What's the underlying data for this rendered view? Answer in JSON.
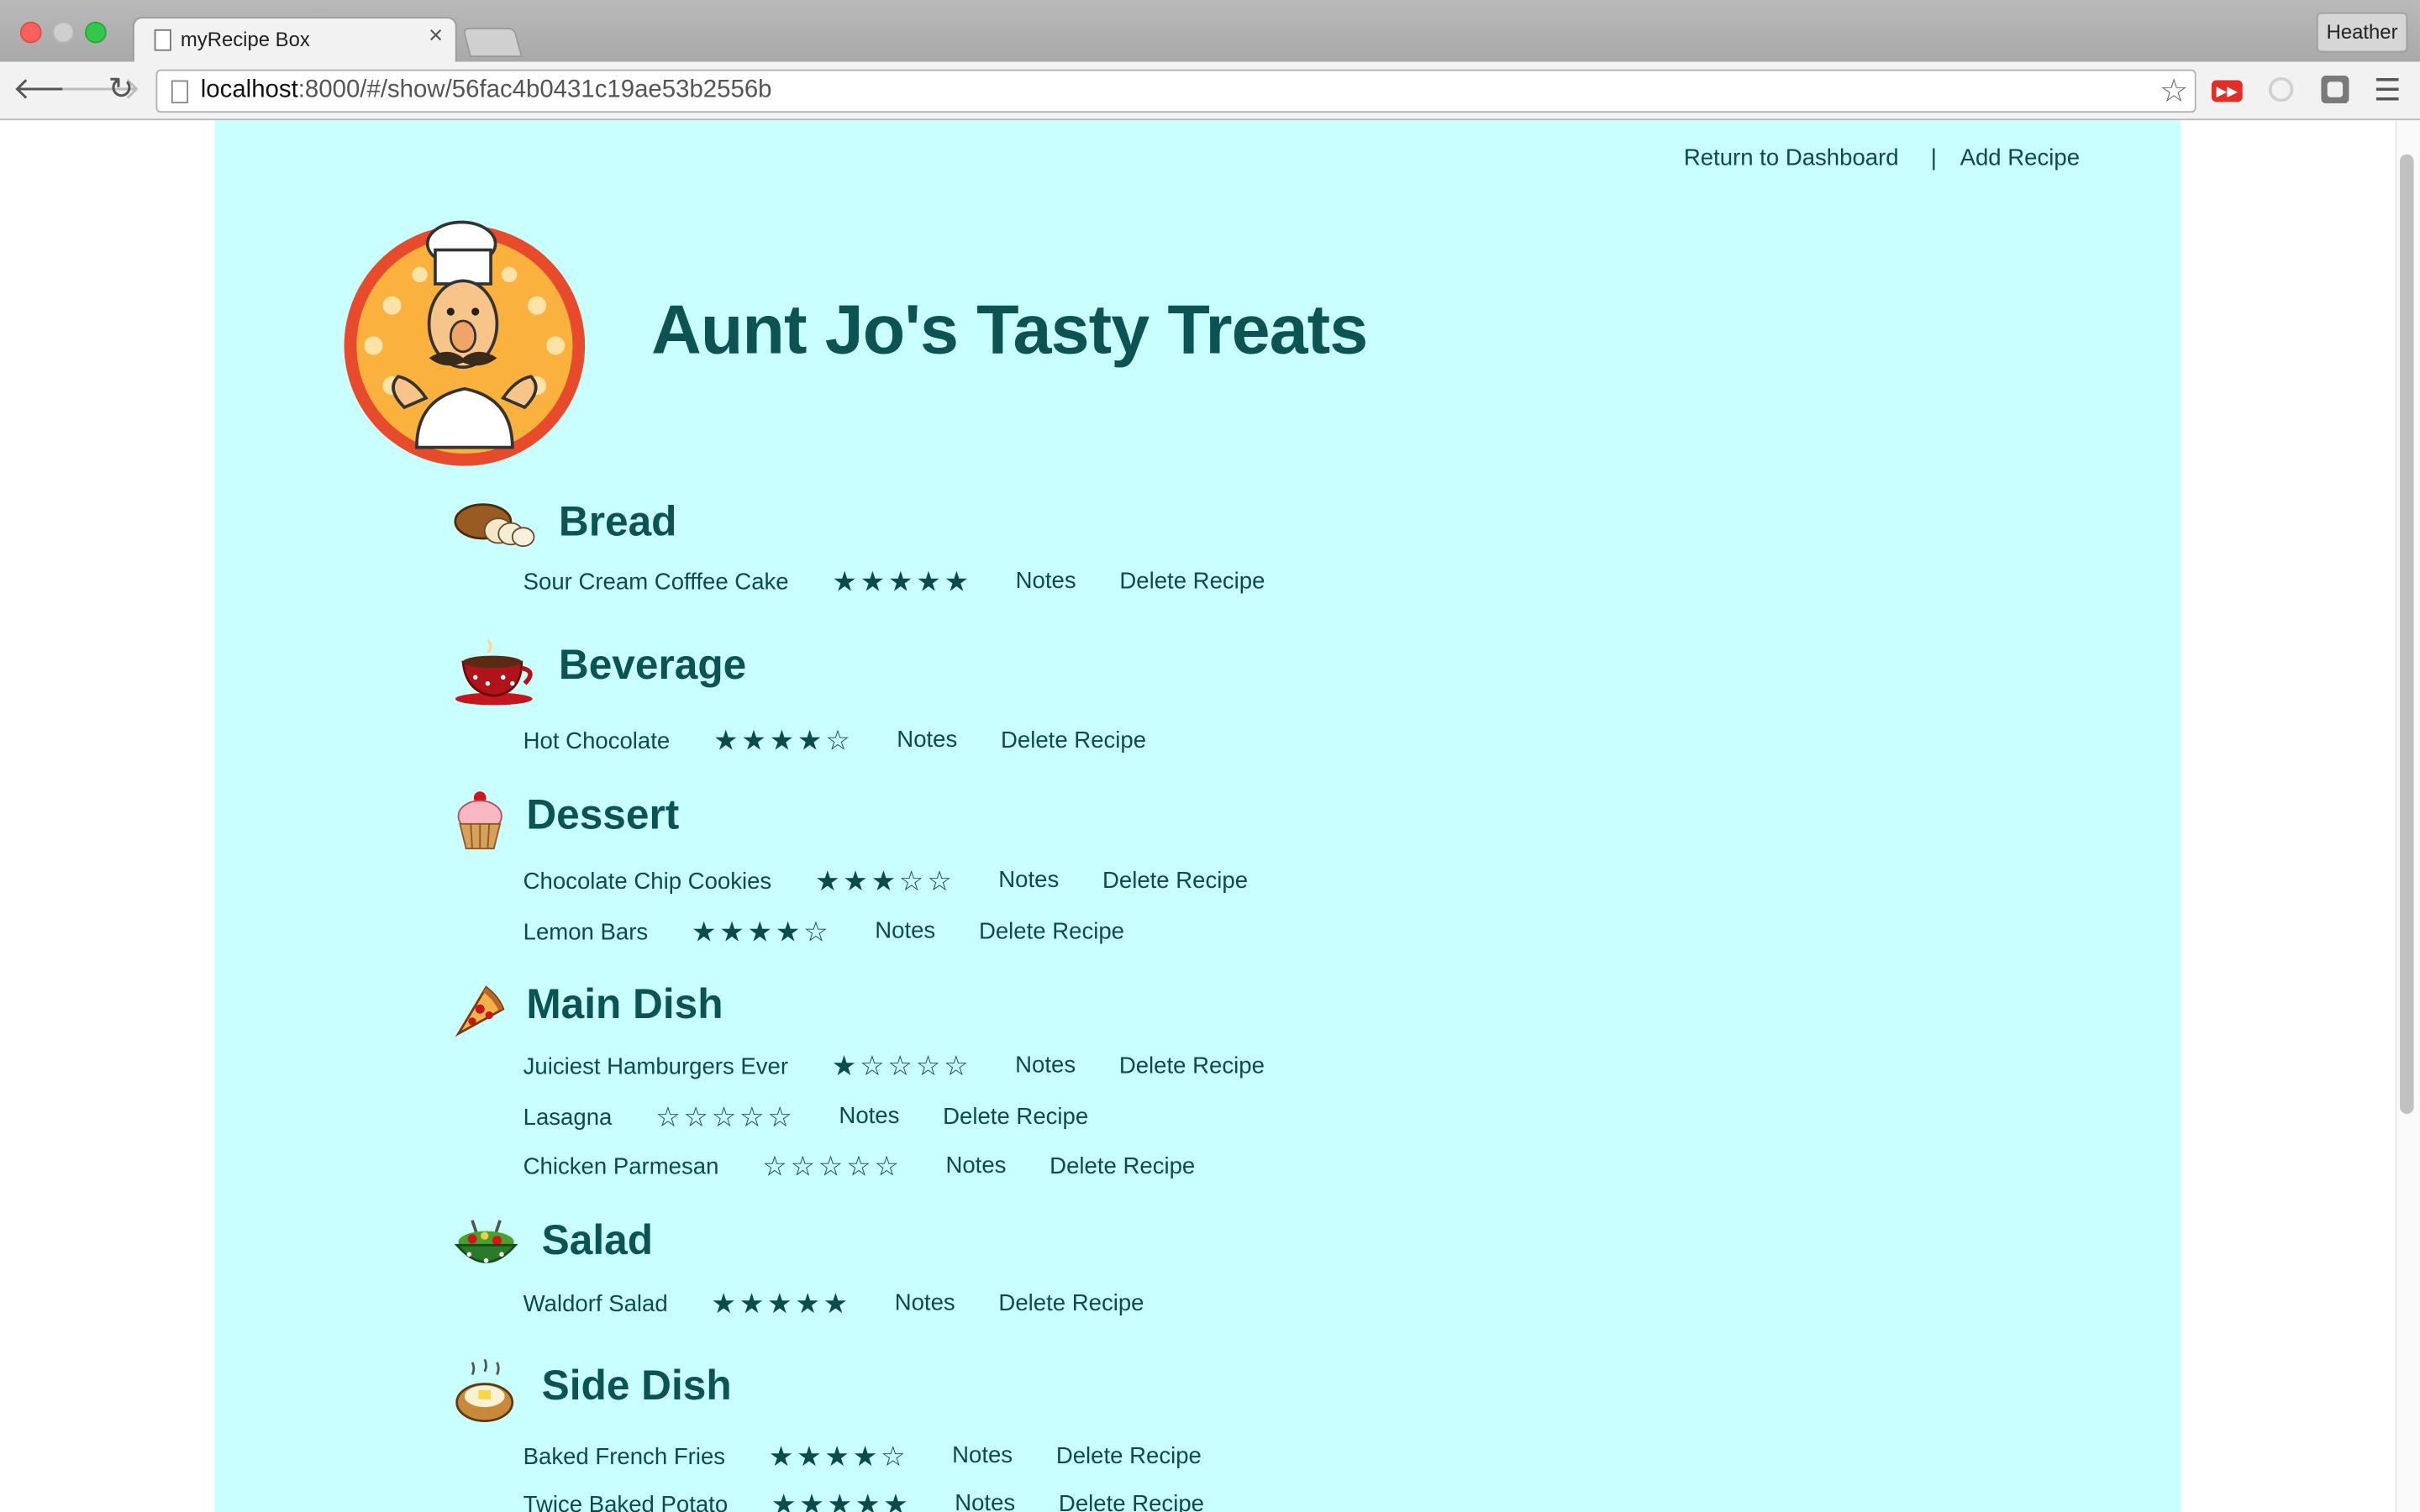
{
  "browser": {
    "tab_title": "myRecipe Box",
    "tab_close": "×",
    "url_host": "localhost",
    "url_path": ":8000/#/show/56fac4b0431c19ae53b2556b",
    "profile_name": "Heather",
    "star_glyph": "☆",
    "back_glyph": "🡐",
    "forward_glyph": "🡒",
    "reload_glyph": "↻",
    "menu_glyph": "☰",
    "yt_glyph": "▶▶"
  },
  "nav": {
    "dashboard": "Return to Dashboard",
    "separator": "|",
    "add_recipe": "Add Recipe"
  },
  "site": {
    "title": "Aunt Jo's Tasty Treats"
  },
  "labels": {
    "notes": "Notes",
    "delete": "Delete Recipe"
  },
  "categories": [
    {
      "name": "Bread",
      "icon": "bread-icon"
    },
    {
      "name": "Beverage",
      "icon": "teacup-icon"
    },
    {
      "name": "Dessert",
      "icon": "cupcake-icon"
    },
    {
      "name": "Main Dish",
      "icon": "pizza-slice-icon"
    },
    {
      "name": "Salad",
      "icon": "salad-bowl-icon"
    },
    {
      "name": "Side Dish",
      "icon": "baked-potato-icon"
    }
  ],
  "recipes": [
    {
      "name": "Sour Cream Cofffee Cake",
      "stars": "★★★★★",
      "rating": 5
    },
    {
      "name": "Hot Chocolate",
      "stars": "★★★★☆",
      "rating": 4
    },
    {
      "name": "Chocolate Chip Cookies",
      "stars": "★★★☆☆",
      "rating": 3
    },
    {
      "name": "Lemon Bars",
      "stars": "★★★★☆",
      "rating": 4
    },
    {
      "name": "Juiciest Hamburgers Ever",
      "stars": "★☆☆☆☆",
      "rating": 1
    },
    {
      "name": "Lasagna",
      "stars": "☆☆☆☆☆",
      "rating": 0
    },
    {
      "name": "Chicken Parmesan",
      "stars": "☆☆☆☆☆",
      "rating": 0
    },
    {
      "name": "Waldorf Salad",
      "stars": "★★★★★",
      "rating": 5
    },
    {
      "name": "Baked French Fries",
      "stars": "★★★★☆",
      "rating": 4
    },
    {
      "name": "Twice Baked Potato",
      "stars": "★★★★★",
      "rating": 5
    }
  ],
  "colors": {
    "page_bg": "#caffff",
    "heading": "#0c5454",
    "text": "#0c4b4b"
  }
}
